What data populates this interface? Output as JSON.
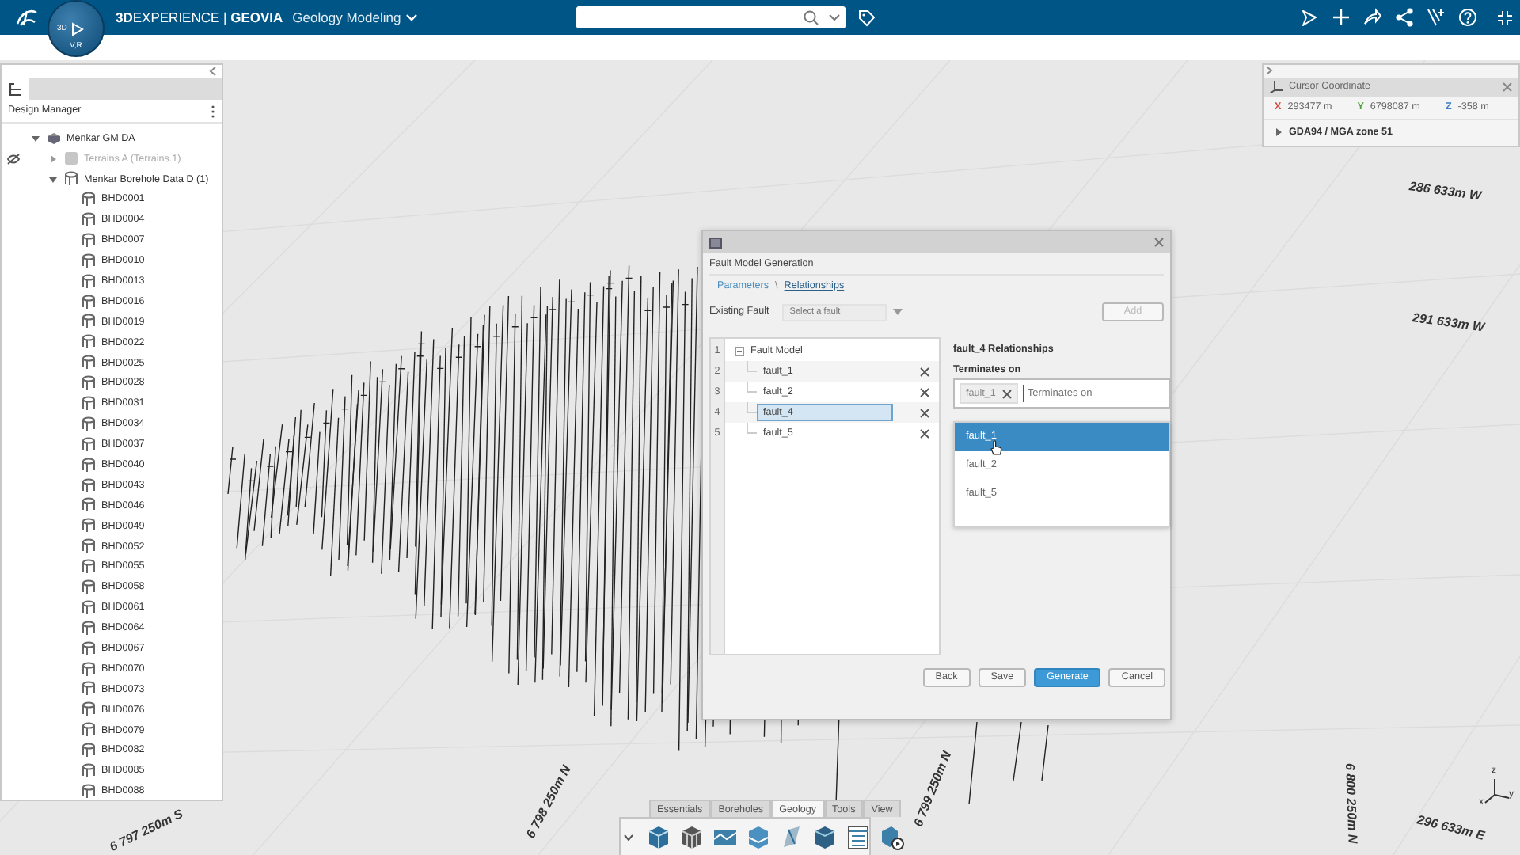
{
  "top_bar": {
    "brand": "**3D**EXPERIENCE | **GEOVIA**",
    "app_name": "Geology Modeling",
    "compass": {
      "left_label": "3D",
      "bottom_label": "V,R"
    }
  },
  "design_manager": {
    "title": "Design Manager",
    "tree": [
      {
        "label": "Menkar GM DA",
        "kind": "model",
        "expanded": true,
        "hidden": false,
        "children": [
          {
            "label": "Terrains A (Terrains.1)",
            "kind": "terrain",
            "expanded": false,
            "hidden": true
          },
          {
            "label": "Menkar Borehole Data D (1)",
            "kind": "borehole-set",
            "expanded": true,
            "hidden": false,
            "children": [
              {
                "label": "BHD0001",
                "kind": "borehole"
              },
              {
                "label": "BHD0004",
                "kind": "borehole"
              },
              {
                "label": "BHD0007",
                "kind": "borehole"
              },
              {
                "label": "BHD0010",
                "kind": "borehole"
              },
              {
                "label": "BHD0013",
                "kind": "borehole"
              },
              {
                "label": "BHD0016",
                "kind": "borehole"
              },
              {
                "label": "BHD0019",
                "kind": "borehole"
              },
              {
                "label": "BHD0022",
                "kind": "borehole"
              },
              {
                "label": "BHD0025",
                "kind": "borehole"
              },
              {
                "label": "BHD0028",
                "kind": "borehole"
              },
              {
                "label": "BHD0031",
                "kind": "borehole"
              },
              {
                "label": "BHD0034",
                "kind": "borehole"
              },
              {
                "label": "BHD0037",
                "kind": "borehole"
              },
              {
                "label": "BHD0040",
                "kind": "borehole"
              },
              {
                "label": "BHD0043",
                "kind": "borehole"
              },
              {
                "label": "BHD0046",
                "kind": "borehole"
              },
              {
                "label": "BHD0049",
                "kind": "borehole"
              },
              {
                "label": "BHD0052",
                "kind": "borehole"
              },
              {
                "label": "BHD0055",
                "kind": "borehole"
              },
              {
                "label": "BHD0058",
                "kind": "borehole"
              },
              {
                "label": "BHD0061",
                "kind": "borehole"
              },
              {
                "label": "BHD0064",
                "kind": "borehole"
              },
              {
                "label": "BHD0067",
                "kind": "borehole"
              },
              {
                "label": "BHD0070",
                "kind": "borehole"
              },
              {
                "label": "BHD0073",
                "kind": "borehole"
              },
              {
                "label": "BHD0076",
                "kind": "borehole"
              },
              {
                "label": "BHD0079",
                "kind": "borehole"
              },
              {
                "label": "BHD0082",
                "kind": "borehole"
              },
              {
                "label": "BHD0085",
                "kind": "borehole"
              },
              {
                "label": "BHD0088",
                "kind": "borehole"
              }
            ]
          }
        ]
      }
    ]
  },
  "cursor_coordinate": {
    "title": "Cursor Coordinate",
    "coordinates": [
      {
        "axis": "X",
        "value": "293477 m",
        "color": "#d9453c"
      },
      {
        "axis": "Y",
        "value": "6798087 m",
        "color": "#4fa03c"
      },
      {
        "axis": "Z",
        "value": "-358 m",
        "color": "#3f7fc4"
      }
    ],
    "crs": "GDA94 / MGA zone 51",
    "crs_expanded": false
  },
  "dialog": {
    "title": "Fault Model Generation",
    "breadcrumb": [
      {
        "label": "Parameters",
        "selected": false
      },
      {
        "label": "Relationships",
        "selected": true
      }
    ],
    "breadcrumb_separator": "\\",
    "existing_fault": {
      "label": "Existing Fault",
      "placeholder": "Select a fault",
      "disabled": true
    },
    "add_button": {
      "label": "Add",
      "disabled": true
    },
    "fault_tree": {
      "line_numbers": [
        "1",
        "2",
        "3",
        "4",
        "5"
      ],
      "root": {
        "label": "Fault Model",
        "expanded": true
      },
      "faults": [
        {
          "label": "fault_1",
          "selected": false
        },
        {
          "label": "fault_2",
          "selected": false
        },
        {
          "label": "fault_4",
          "selected": true
        },
        {
          "label": "fault_5",
          "selected": false
        }
      ]
    },
    "relationships": {
      "heading": "fault_4 Relationships",
      "field_label": "Terminates on",
      "tags": [
        "fault_1"
      ],
      "placeholder": "Terminates on",
      "options": [
        {
          "label": "fault_1",
          "selected": true
        },
        {
          "label": "fault_2",
          "selected": false
        },
        {
          "label": "fault_5",
          "selected": false
        }
      ]
    },
    "buttons": [
      {
        "label": "Back",
        "kind": "default"
      },
      {
        "label": "Save",
        "kind": "default"
      },
      {
        "label": "Generate",
        "kind": "primary"
      },
      {
        "label": "Cancel",
        "kind": "default"
      }
    ]
  },
  "scene": {
    "axis_labels": [
      "286 633m W",
      "291 633m W",
      "6 797 250m S",
      "6 798 250m N",
      "6 799 250m N",
      "6 800 250m N",
      "296 633m E"
    ],
    "gizmo_labels": [
      "z",
      "x",
      "y"
    ]
  },
  "toolbar": {
    "tabs": [
      {
        "label": "Essentials",
        "selected": false
      },
      {
        "label": "Boreholes",
        "selected": false
      },
      {
        "label": "Geology",
        "selected": true
      },
      {
        "label": "Tools",
        "selected": false
      },
      {
        "label": "View",
        "selected": false
      }
    ]
  }
}
